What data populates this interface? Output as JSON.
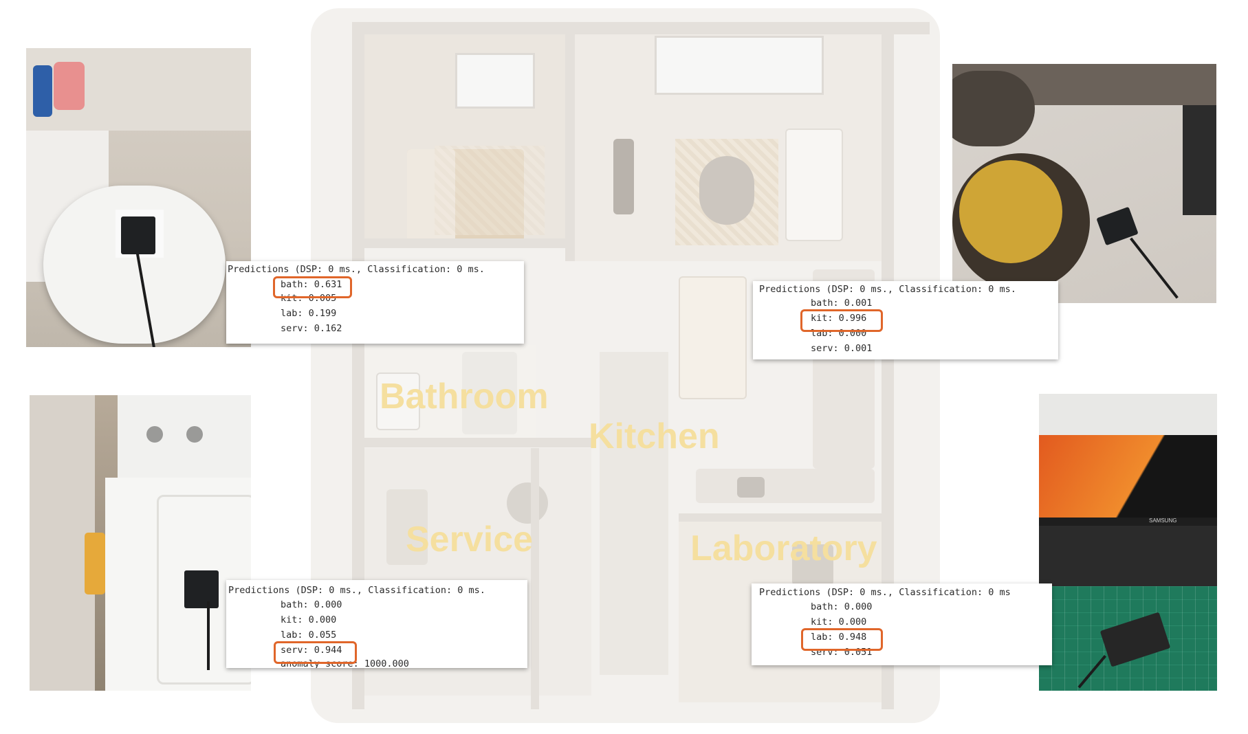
{
  "rooms": {
    "bathroom": "Bathroom",
    "kitchen": "Kitchen",
    "service": "Service",
    "laboratory": "Laboratory"
  },
  "panels": {
    "bath": {
      "header": "Predictions (DSP: 0 ms., Classification: 0 ms.",
      "l1": "bath: 0.631",
      "l2": "kit: 0.005",
      "l3": "lab: 0.199",
      "l4": "serv: 0.162"
    },
    "kit": {
      "header": "Predictions (DSP: 0 ms., Classification: 0 ms.",
      "l1": "bath: 0.001",
      "l2": "kit: 0.996",
      "l3": "lab: 0.000",
      "l4": "serv: 0.001"
    },
    "serv": {
      "header": "Predictions (DSP: 0 ms., Classification: 0 ms.",
      "l1": "bath: 0.000",
      "l2": "kit: 0.000",
      "l3": "lab: 0.055",
      "l4": "serv: 0.944",
      "l5": "anomaly score: 1000.000"
    },
    "lab": {
      "header": "Predictions (DSP: 0 ms., Classification: 0 ms",
      "l1": "bath: 0.000",
      "l2": "kit: 0.000",
      "l3": "lab: 0.948",
      "l4": "serv: 0.051"
    }
  },
  "colors": {
    "highlight": "#e0662a",
    "room_label": "#f5df9f"
  },
  "monitor_brand": "SAMSUNG"
}
